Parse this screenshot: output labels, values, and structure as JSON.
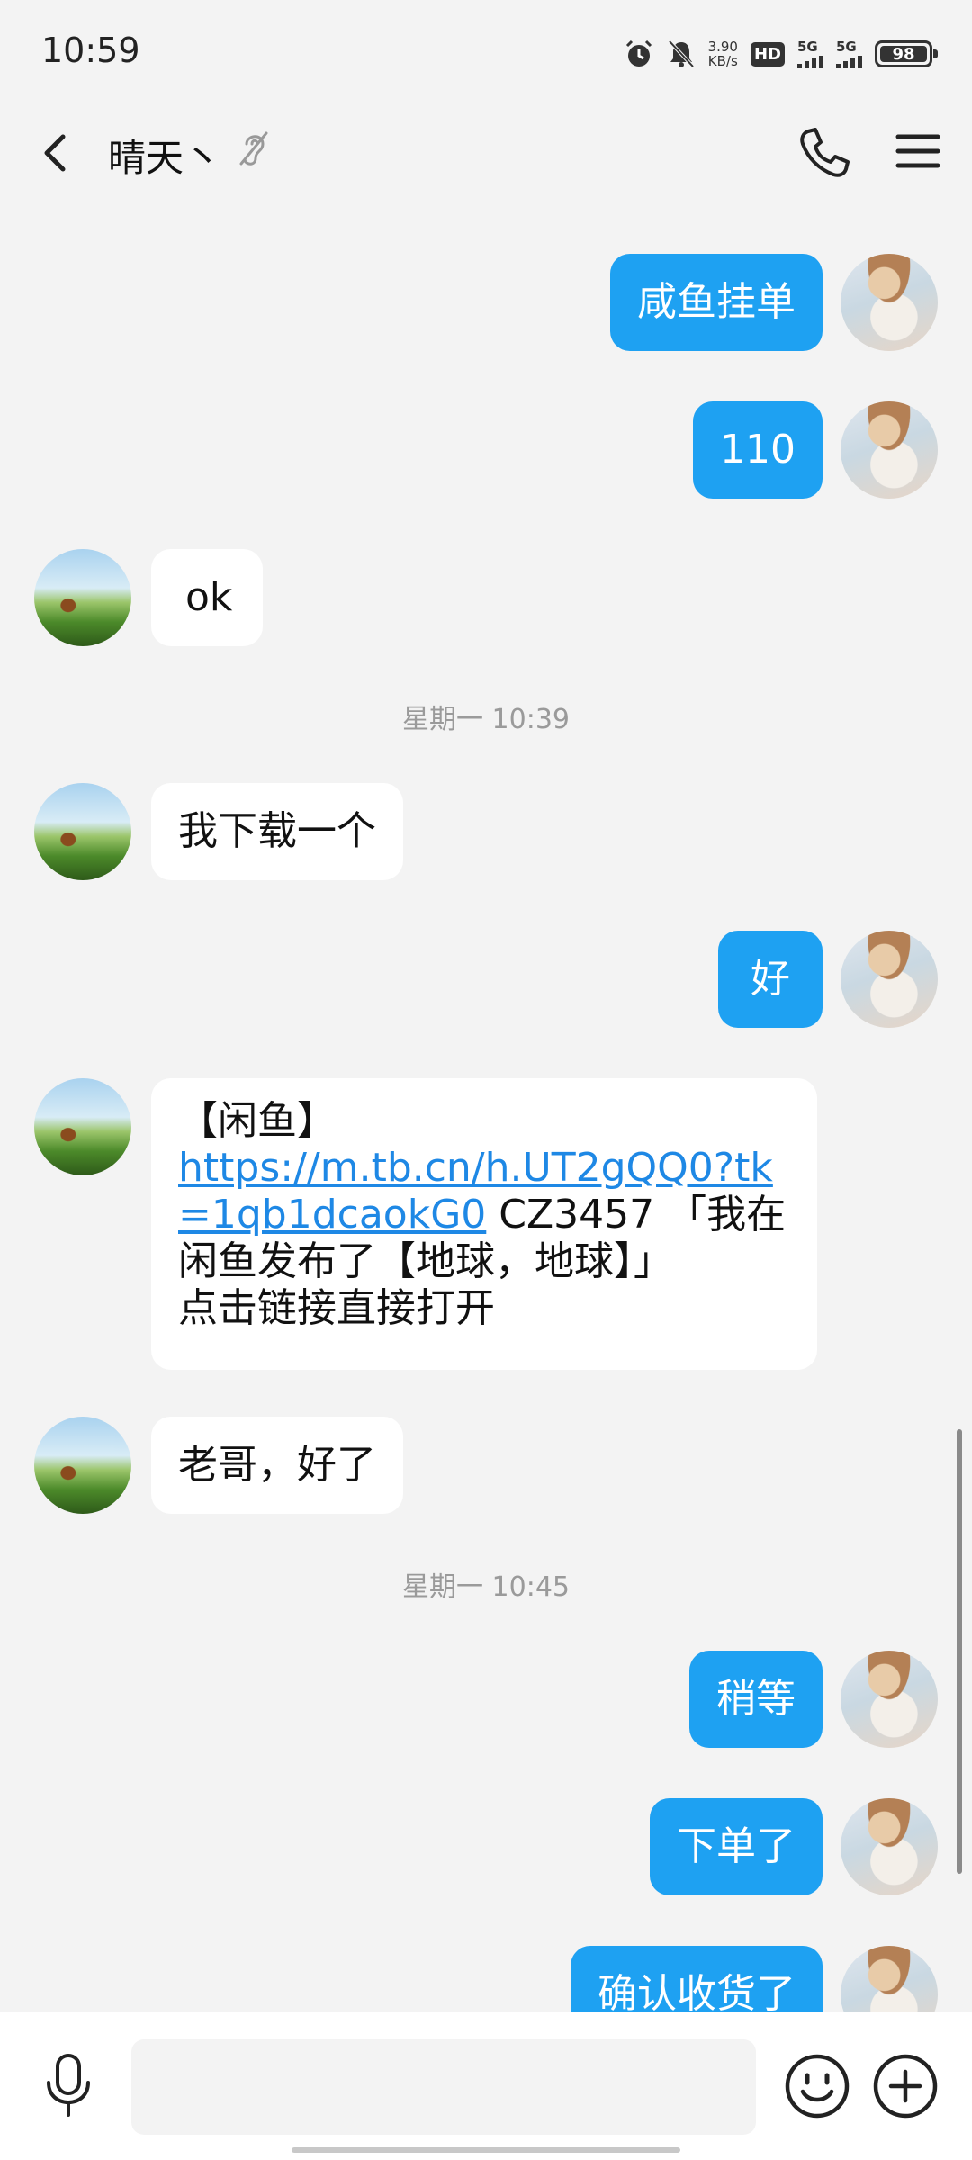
{
  "status_bar": {
    "time": "10:59",
    "net_speed_value": "3.90",
    "net_speed_unit": "KB/s",
    "hd_label": "HD",
    "sim1_label": "5G",
    "sim2_label": "5G",
    "battery": "98",
    "icons": [
      "alarm-icon",
      "mute-icon",
      "hd-icon",
      "signal-icon",
      "signal-icon",
      "battery-icon"
    ]
  },
  "header": {
    "contact_name": "晴天丶",
    "icons": [
      "back-icon",
      "ear-icon",
      "call-icon",
      "menu-icon"
    ]
  },
  "messages": [
    {
      "side": "me",
      "text": "咸鱼挂单"
    },
    {
      "side": "me",
      "text": "110"
    },
    {
      "side": "other",
      "text": "ok"
    },
    {
      "type": "time",
      "text": "星期一 10:39"
    },
    {
      "side": "other",
      "text": "我下载一个"
    },
    {
      "side": "me",
      "text": "好"
    },
    {
      "side": "other",
      "prefix": "【闲鱼】",
      "link_line1": "https://m.tb.cn/h.UT2gQQ0?tk",
      "link_line2": "=1qb1dcaokG0",
      "rest1": " CZ3457 「我在",
      "rest2": "闲鱼发布了【地球，地球】」",
      "rest3": "点击链接直接打开"
    },
    {
      "side": "other",
      "text": "老哥，好了"
    },
    {
      "type": "time",
      "text": "星期一 10:45"
    },
    {
      "side": "me",
      "text": "稍等"
    },
    {
      "side": "me",
      "text": "下单了"
    },
    {
      "side": "me",
      "text": "确认收货了"
    }
  ],
  "input_bar": {
    "placeholder": "",
    "icons": [
      "mic-icon",
      "emoji-icon",
      "plus-icon"
    ]
  },
  "colors": {
    "my_bubble": "#1ea1f2",
    "other_bubble": "#ffffff",
    "background": "#f3f3f3",
    "link": "#1e88e5"
  }
}
